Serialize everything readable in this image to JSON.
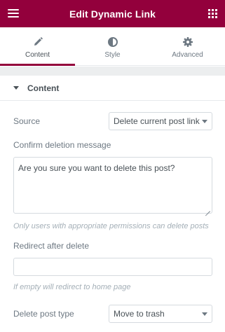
{
  "header": {
    "title": "Edit Dynamic Link",
    "menu_icon": "hamburger-icon",
    "apps_icon": "grid-icon",
    "brand_color": "#93003c"
  },
  "tabs": [
    {
      "label": "Content",
      "icon": "pencil-icon",
      "active": true
    },
    {
      "label": "Style",
      "icon": "half-circle-icon",
      "active": false
    },
    {
      "label": "Advanced",
      "icon": "gear-icon",
      "active": false
    }
  ],
  "section": {
    "title": "Content",
    "expanded": true
  },
  "fields": {
    "source": {
      "label": "Source",
      "value": "Delete current post link"
    },
    "confirm_message": {
      "label": "Confirm deletion message",
      "value": "Are you sure you want to delete this post?",
      "note": "Only users with appropriate permissions can delete posts"
    },
    "redirect": {
      "label": "Redirect after delete",
      "value": "",
      "note": "If empty will redirect to home page"
    },
    "delete_type": {
      "label": "Delete post type",
      "value": "Move to trash"
    }
  }
}
